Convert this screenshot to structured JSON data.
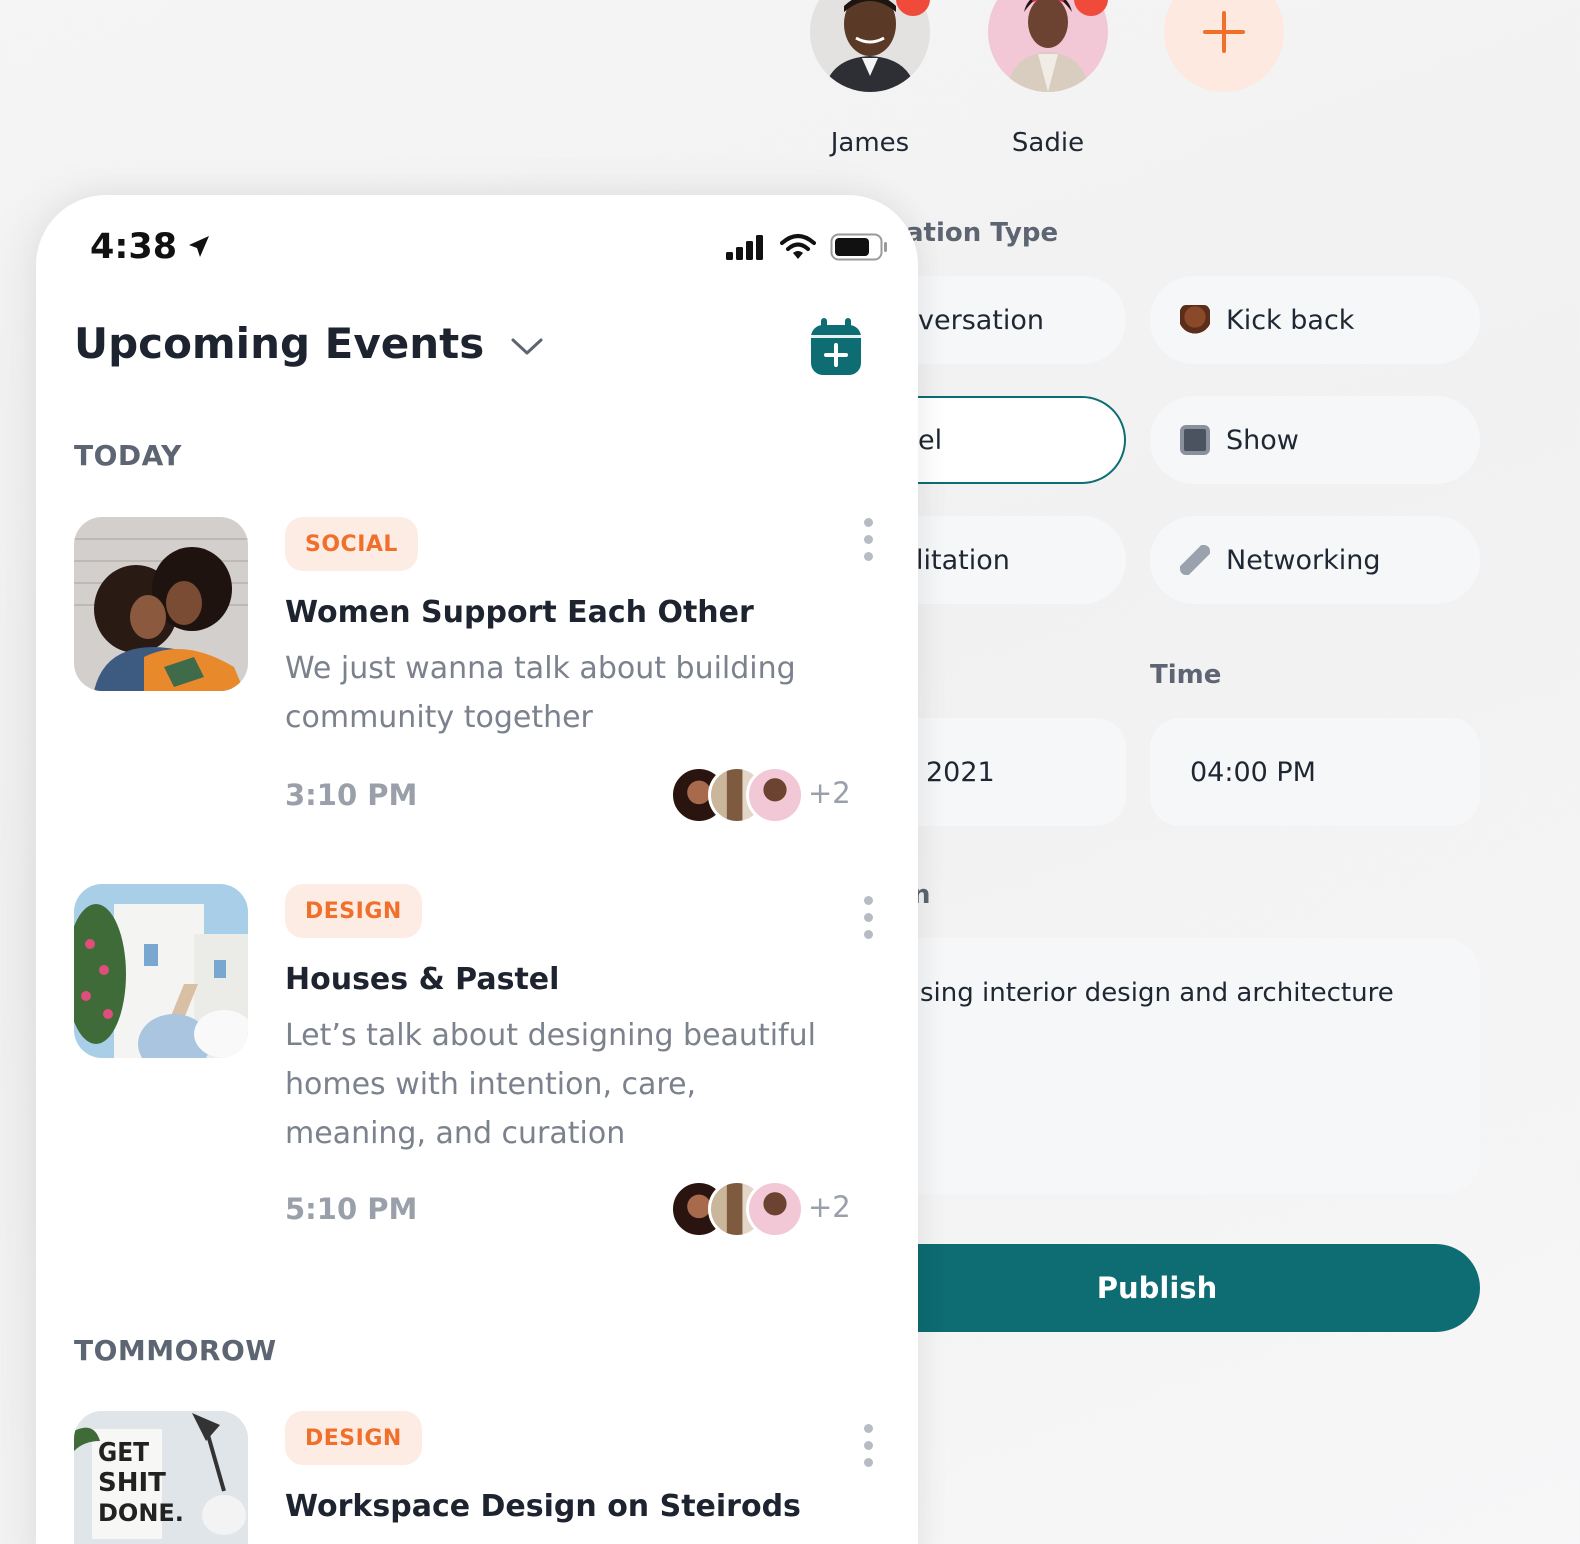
{
  "invitees": [
    {
      "name": "James",
      "icon": "avatar-james"
    },
    {
      "name": "Sadie",
      "icon": "avatar-sadie"
    }
  ],
  "add_invitee_icon": "plus-icon",
  "form": {
    "conversation_type_label": "ation Type",
    "types": [
      {
        "label": "versation",
        "selected": false
      },
      {
        "label": "Kick back",
        "icon": "kick-back-emoji",
        "selected": false
      },
      {
        "label": "el",
        "selected": true
      },
      {
        "label": "Show",
        "icon": "tv-emoji",
        "selected": false
      },
      {
        "label": "litation",
        "selected": false
      },
      {
        "label": "Networking",
        "icon": "satellite-emoji",
        "selected": false
      }
    ],
    "time_label": "Time",
    "date_value": "2021",
    "time_value": "04:00 PM",
    "description_label": "n",
    "description_value": "sing interior design and architecture",
    "publish_label": "Publish"
  },
  "phone": {
    "status_time": "4:38",
    "title": "Upcoming Events",
    "sections": [
      {
        "label": "TODAY",
        "events": [
          {
            "tag": "SOCIAL",
            "title": "Women Support Each Other",
            "description": "We just wanna talk about building community together",
            "time": "3:10 PM",
            "extra_count": "+2"
          },
          {
            "tag": "DESIGN",
            "title": "Houses & Pastel",
            "description": "Let’s talk about designing beautiful homes with intention, care, meaning, and curation",
            "time": "5:10 PM",
            "extra_count": "+2"
          }
        ]
      },
      {
        "label": "TOMMOROW",
        "events": [
          {
            "tag": "DESIGN",
            "title": "Workspace Design on Steirods",
            "thumb_text": "GET SHIT DONE."
          }
        ]
      }
    ]
  },
  "colors": {
    "accent": "#0e6c73",
    "tag_text": "#f06f2b",
    "tag_bg": "#fdece3",
    "badge": "#ef4a3a"
  }
}
